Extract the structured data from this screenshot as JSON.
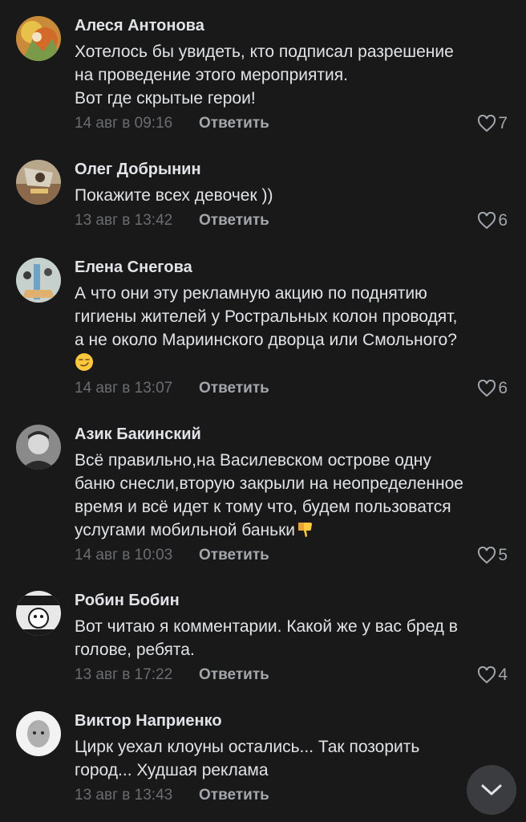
{
  "comments": [
    {
      "author": "Алеся Антонова",
      "text_lines": [
        "Хотелось бы увидеть, кто подписал разрешение",
        "на проведение этого мероприятия.",
        "Вот где скрытые герои!"
      ],
      "date": "14 авг в 09:16",
      "reply_label": "Ответить",
      "likes": "7",
      "avatar_icon": "avatar-photo-icon"
    },
    {
      "author": "Олег Добрынин",
      "text_lines": [
        "Покажите всех девочек ))"
      ],
      "date": "13 авг в 13:42",
      "reply_label": "Ответить",
      "likes": "6",
      "avatar_icon": "avatar-photo-icon"
    },
    {
      "author": "Елена Снегова",
      "text_lines": [
        "А что они эту рекламную акцию по поднятию",
        "гигиены жителей у Ростральных колон проводят,",
        "а не около Мариинского дворца или Смольного?"
      ],
      "emoji": "smirk-emoji-icon",
      "date": "14 авг в 13:07",
      "reply_label": "Ответить",
      "likes": "6",
      "avatar_icon": "avatar-photo-icon"
    },
    {
      "author": "Азик Бакинский",
      "text_lines": [
        "Всё правильно,на Василевском острове одну",
        "баню снесли,вторую закрыли на неопределенное",
        "время и всё идет к тому что,  будем пользоватся",
        "услугами мобильной баньки"
      ],
      "trailing_emoji": "thumbs-down-emoji-icon",
      "date": "14 авг в 10:03",
      "reply_label": "Ответить",
      "likes": "5",
      "avatar_icon": "avatar-photo-icon"
    },
    {
      "author": "Робин Бобин",
      "text_lines": [
        "Вот читаю я комментарии. Какой же у вас бред в",
        "голове, ребята."
      ],
      "date": "13 авг в 17:22",
      "reply_label": "Ответить",
      "likes": "4",
      "avatar_icon": "avatar-photo-icon"
    },
    {
      "author": "Виктор Наприенко",
      "text_lines": [
        "Цирк уехал клоуны остались... Так позорить",
        "город... Худшая реклама"
      ],
      "date": "13 авг в 13:43",
      "reply_label": "Ответить",
      "likes": "",
      "avatar_icon": "avatar-photo-icon"
    }
  ],
  "colors": {
    "background": "#19191a",
    "text": "#e1e3e6",
    "muted": "#6b6c70",
    "secondary": "#a3a6ab",
    "fab": "#3b3c3f"
  },
  "scroll_button_icon": "chevron-down-icon"
}
